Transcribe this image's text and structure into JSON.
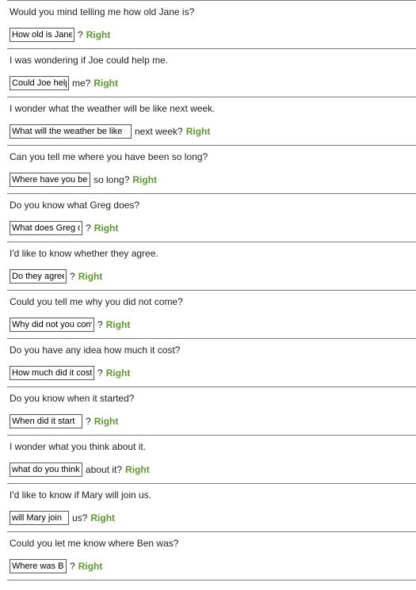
{
  "items": [
    {
      "question": "Would you mind telling me how old Jane is?",
      "answer": "How old is Jane",
      "suffix": "?",
      "feedback": "Right"
    },
    {
      "question": "I was wondering if Joe could help me.",
      "answer": "Could Joe help",
      "suffix": "me?",
      "feedback": "Right"
    },
    {
      "question": "I wonder what the weather will be like next week.",
      "answer": "What will the weather be like",
      "suffix": "next week?",
      "feedback": "Right"
    },
    {
      "question": "Can you tell me where you have been so long?",
      "answer": "Where have you been",
      "suffix": "so long?",
      "feedback": "Right"
    },
    {
      "question": "Do you know what Greg does?",
      "answer": "What does Greg do",
      "suffix": "?",
      "feedback": "Right"
    },
    {
      "question": "I'd like to know whether they agree.",
      "answer": "Do they agree",
      "suffix": "?",
      "feedback": "Right"
    },
    {
      "question": "Could you tell me why you did not come?",
      "answer": "Why did not you come",
      "suffix": "?",
      "feedback": "Right"
    },
    {
      "question": "Do you have any idea how much it cost?",
      "answer": "How much did it cost",
      "suffix": "?",
      "feedback": "Right"
    },
    {
      "question": "Do you know when it started?",
      "answer": "When did it start",
      "suffix": "?",
      "feedback": "Right"
    },
    {
      "question": "I wonder what you think about it.",
      "answer": "what do you think",
      "suffix": "about it?",
      "feedback": "Right"
    },
    {
      "question": "I'd like to know if Mary will join us.",
      "answer": "will Mary join",
      "suffix": "us?",
      "feedback": "Right"
    },
    {
      "question": "Could you let me know where Ben was?",
      "answer": "Where was Ben",
      "suffix": "?",
      "feedback": "Right"
    }
  ]
}
